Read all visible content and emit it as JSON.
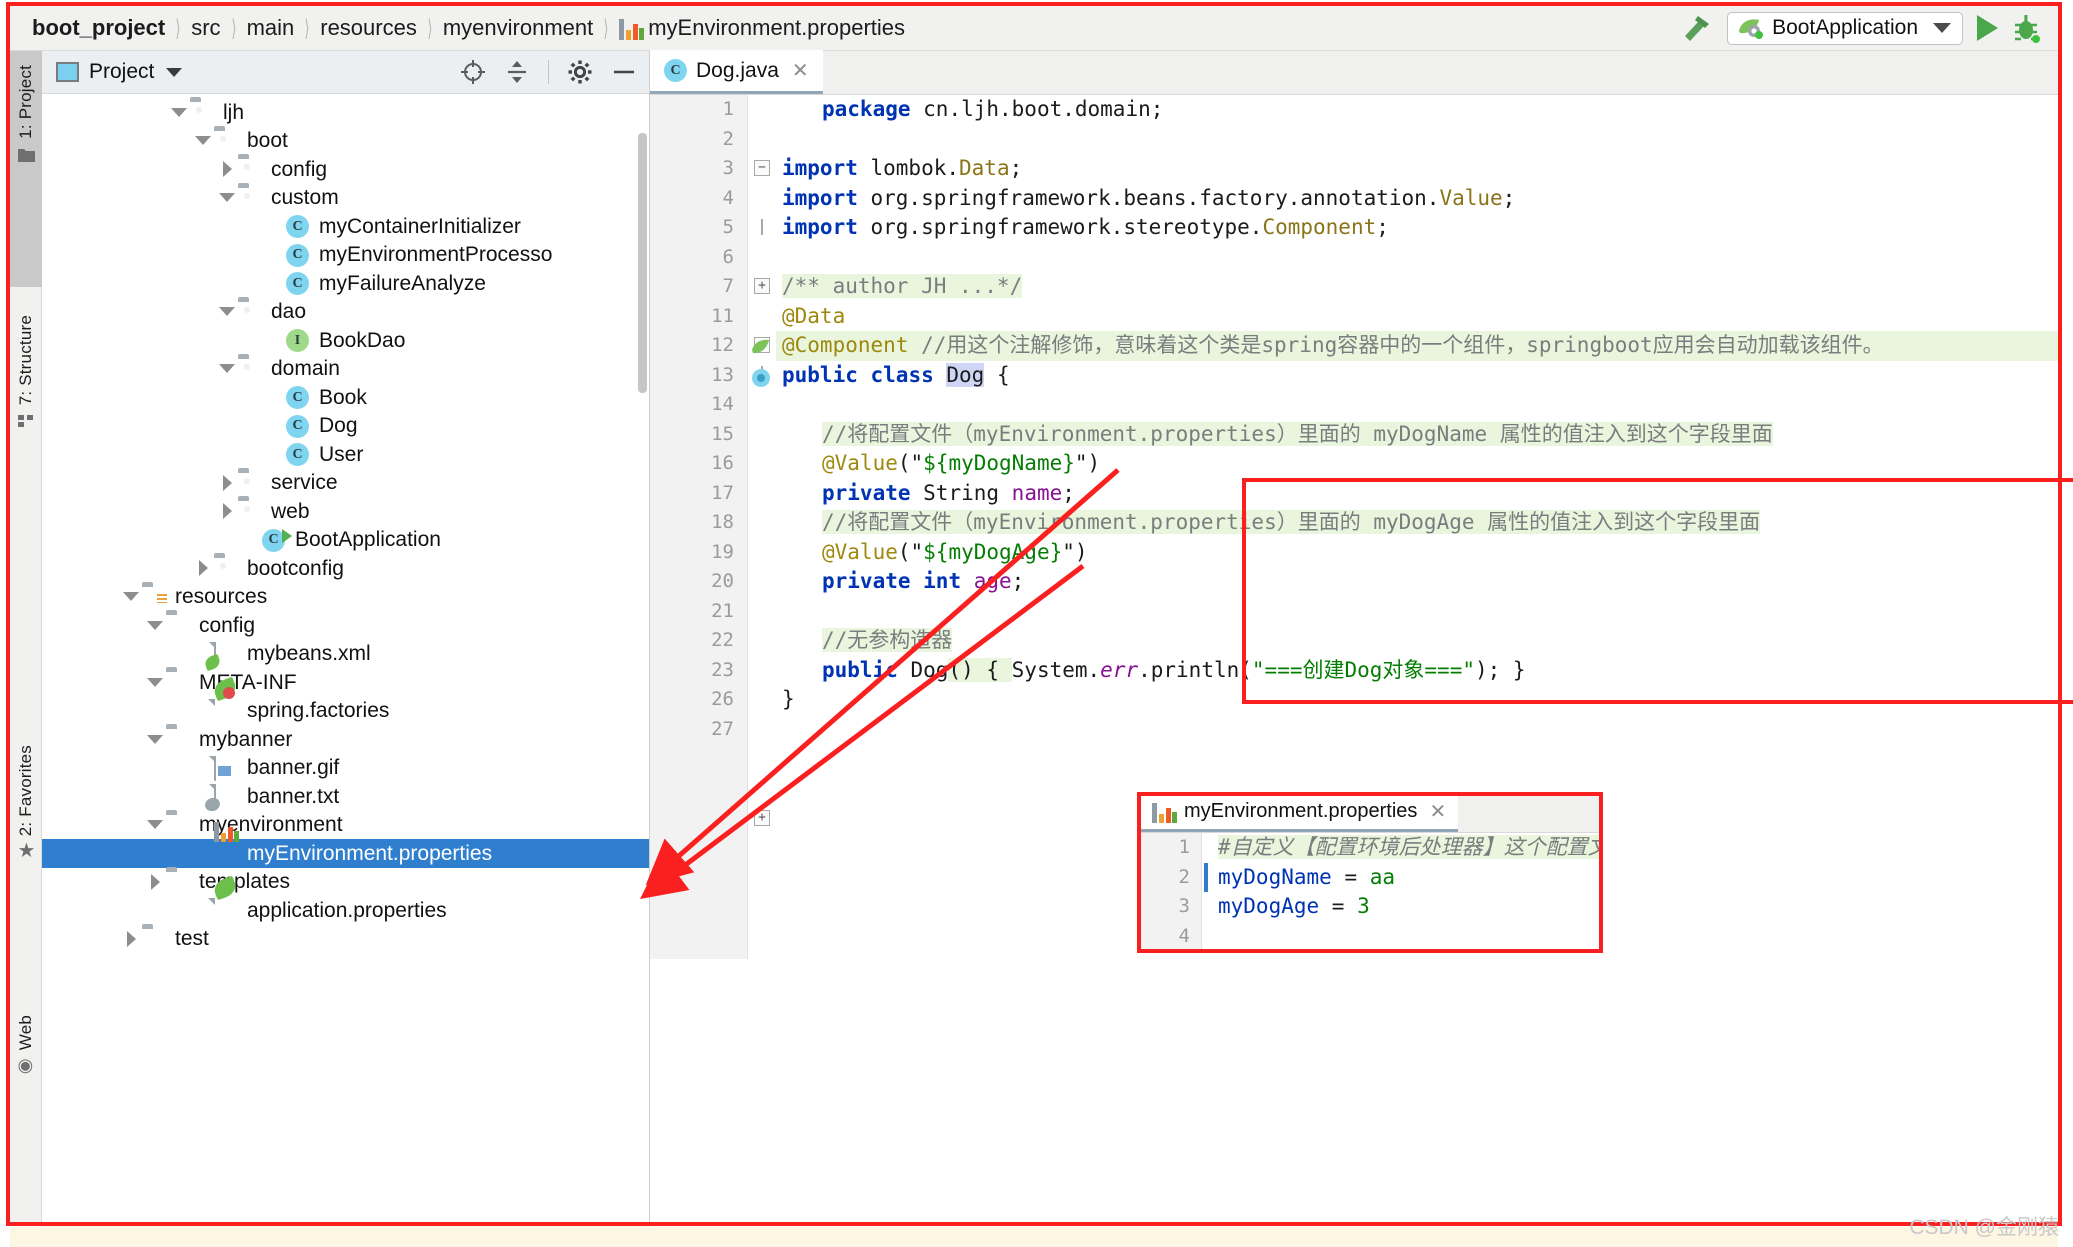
{
  "breadcrumb": {
    "items": [
      "boot_project",
      "src",
      "main",
      "resources",
      "myenvironment"
    ],
    "file": "myEnvironment.properties",
    "file_icon": "properties-file-icon"
  },
  "toolbar": {
    "build_icon": "hammer-icon",
    "run_config": "BootApplication",
    "run_config_icon": "spring-boot-icon",
    "dropdown_icon": "chevron-down-icon",
    "run_icon": "run-play-icon",
    "debug_icon": "debug-bug-icon"
  },
  "left_strip": {
    "tabs": [
      {
        "label": "1: Project",
        "icon": "folder-icon",
        "active": true
      },
      {
        "label": "7: Structure",
        "icon": "structure-icon",
        "active": false
      },
      {
        "label": "2: Favorites",
        "icon": "star-icon",
        "active": false
      },
      {
        "label": "Web",
        "icon": "globe-icon",
        "active": false
      }
    ]
  },
  "project_panel": {
    "title": "Project",
    "icons": [
      "locate-target-icon",
      "collapse-all-icon",
      "gear-icon",
      "minimize-icon"
    ],
    "tree": [
      {
        "label": "ljh",
        "indent": 5,
        "twisty": "open",
        "icon": "folder",
        "selected": false
      },
      {
        "label": "boot",
        "indent": 6,
        "twisty": "open",
        "icon": "folder",
        "selected": false
      },
      {
        "label": "config",
        "indent": 7,
        "twisty": "closed",
        "icon": "folder",
        "selected": false
      },
      {
        "label": "custom",
        "indent": 7,
        "twisty": "open",
        "icon": "folder",
        "selected": false
      },
      {
        "label": "myContainerInitializer",
        "indent": 9,
        "twisty": "none",
        "icon": "class",
        "selected": false
      },
      {
        "label": "myEnvironmentProcesso",
        "indent": 9,
        "twisty": "none",
        "icon": "class",
        "selected": false
      },
      {
        "label": "myFailureAnalyze",
        "indent": 9,
        "twisty": "none",
        "icon": "class",
        "selected": false
      },
      {
        "label": "dao",
        "indent": 7,
        "twisty": "open",
        "icon": "folder",
        "selected": false
      },
      {
        "label": "BookDao",
        "indent": 9,
        "twisty": "none",
        "icon": "interface",
        "selected": false
      },
      {
        "label": "domain",
        "indent": 7,
        "twisty": "open",
        "icon": "folder",
        "selected": false
      },
      {
        "label": "Book",
        "indent": 9,
        "twisty": "none",
        "icon": "class",
        "selected": false
      },
      {
        "label": "Dog",
        "indent": 9,
        "twisty": "none",
        "icon": "class",
        "selected": false
      },
      {
        "label": "User",
        "indent": 9,
        "twisty": "none",
        "icon": "class",
        "selected": false
      },
      {
        "label": "service",
        "indent": 7,
        "twisty": "closed",
        "icon": "folder",
        "selected": false
      },
      {
        "label": "web",
        "indent": 7,
        "twisty": "closed",
        "icon": "folder",
        "selected": false
      },
      {
        "label": "BootApplication",
        "indent": 8,
        "twisty": "none",
        "icon": "class-run",
        "selected": false
      },
      {
        "label": "bootconfig",
        "indent": 6,
        "twisty": "closed",
        "icon": "folder",
        "selected": false
      },
      {
        "label": "resources",
        "indent": 3,
        "twisty": "open",
        "icon": "folder-res",
        "selected": false
      },
      {
        "label": "config",
        "indent": 4,
        "twisty": "open",
        "icon": "folder-plain",
        "selected": false
      },
      {
        "label": "mybeans.xml",
        "indent": 6,
        "twisty": "none",
        "icon": "file-xml",
        "selected": false
      },
      {
        "label": "META-INF",
        "indent": 4,
        "twisty": "open",
        "icon": "folder-plain",
        "selected": false
      },
      {
        "label": "spring.factories",
        "indent": 6,
        "twisty": "none",
        "icon": "file-spring-star",
        "selected": false
      },
      {
        "label": "mybanner",
        "indent": 4,
        "twisty": "open",
        "icon": "folder-plain",
        "selected": false
      },
      {
        "label": "banner.gif",
        "indent": 6,
        "twisty": "none",
        "icon": "file-image",
        "selected": false
      },
      {
        "label": "banner.txt",
        "indent": 6,
        "twisty": "none",
        "icon": "file-text",
        "selected": false
      },
      {
        "label": "myenvironment",
        "indent": 4,
        "twisty": "open",
        "icon": "folder-plain",
        "selected": false
      },
      {
        "label": "myEnvironment.properties",
        "indent": 6,
        "twisty": "none",
        "icon": "file-props",
        "selected": true
      },
      {
        "label": "templates",
        "indent": 4,
        "twisty": "closed",
        "icon": "folder-plain",
        "selected": false
      },
      {
        "label": "application.properties",
        "indent": 6,
        "twisty": "none",
        "icon": "file-spring",
        "selected": false
      },
      {
        "label": "test",
        "indent": 3,
        "twisty": "closed",
        "icon": "folder-plain",
        "selected": false
      }
    ]
  },
  "editor": {
    "tab": {
      "label": "Dog.java",
      "icon": "java-class-icon",
      "close_icon": "close-icon"
    },
    "line_numbers": [
      "1",
      "2",
      "3",
      "4",
      "5",
      "6",
      "7",
      "11",
      "12",
      "13",
      "14",
      "15",
      "16",
      "17",
      "18",
      "19",
      "20",
      "21",
      "22",
      "23",
      "26",
      "27"
    ],
    "code": {
      "l1_kw": "package",
      "l1_rest": " cn.ljh.boot.domain;",
      "l3_kw": "import",
      "l3_pkg": " lombok.",
      "l3_cls": "Data",
      "l3_end": ";",
      "l4_kw": "import",
      "l4_pkg": " org.springframework.beans.factory.annotation.",
      "l4_cls": "Value",
      "l4_end": ";",
      "l5_kw": "import",
      "l5_pkg": " org.springframework.stereotype.",
      "l5_cls": "Component",
      "l5_end": ";",
      "l7_comment": "/** author JH ...*/",
      "l11_ann": "@Data",
      "l12_ann": "@Component",
      "l12_comment": " //用这个注解修饰，意味着这个类是spring容器中的一个组件，springboot应用会自动加载该组件。",
      "l13_kw1": "public",
      "l13_kw2": "class",
      "l13_name": "Dog",
      "l13_brace": " {",
      "l15_comment": "//将配置文件（myEnvironment.properties）里面的 myDogName 属性的值注入到这个字段里面",
      "l16_ann": "@Value",
      "l16_open": "(\"",
      "l16_val": "${myDogName}",
      "l16_close": "\")",
      "l17_kw": "private",
      "l17_type": " String ",
      "l17_name": "name",
      "l17_end": ";",
      "l18_comment": "//将配置文件（myEnvironment.properties）里面的 myDogAge 属性的值注入到这个字段里面",
      "l19_ann": "@Value",
      "l19_open": "(\"",
      "l19_val": "${myDogAge}",
      "l19_close": "\")",
      "l20_kw1": "private",
      "l20_kw2": " int ",
      "l20_name": "age",
      "l20_end": ";",
      "l22_comment": "//无参构造器",
      "l23_kw": "public",
      "l23_name": " Dog",
      "l23_sig": "() { ",
      "l23_sys": "System.",
      "l23_err": "err",
      "l23_print": ".println(",
      "l23_str": "\"===创建Dog对象===\"",
      "l23_tail": "); }",
      "l26_brace": "}"
    }
  },
  "props_editor": {
    "tab": {
      "label": "myEnvironment.properties",
      "icon": "properties-file-icon",
      "close_icon": "close-icon"
    },
    "line_numbers": [
      "1",
      "2",
      "3",
      "4"
    ],
    "lines": {
      "l1_comment": "#自定义【配置环境后处理器】这个配置文件",
      "l2_key": "myDogName",
      "l2_eq": " = ",
      "l2_val": "aa",
      "l3_key": "myDogAge",
      "l3_eq": " = ",
      "l3_val": "3"
    }
  },
  "annotations": {
    "color": "#fa2020",
    "arrow_note": "two red arrows linking properties keys to @Value placeholders"
  },
  "watermark": "CSDN @金刚猿"
}
